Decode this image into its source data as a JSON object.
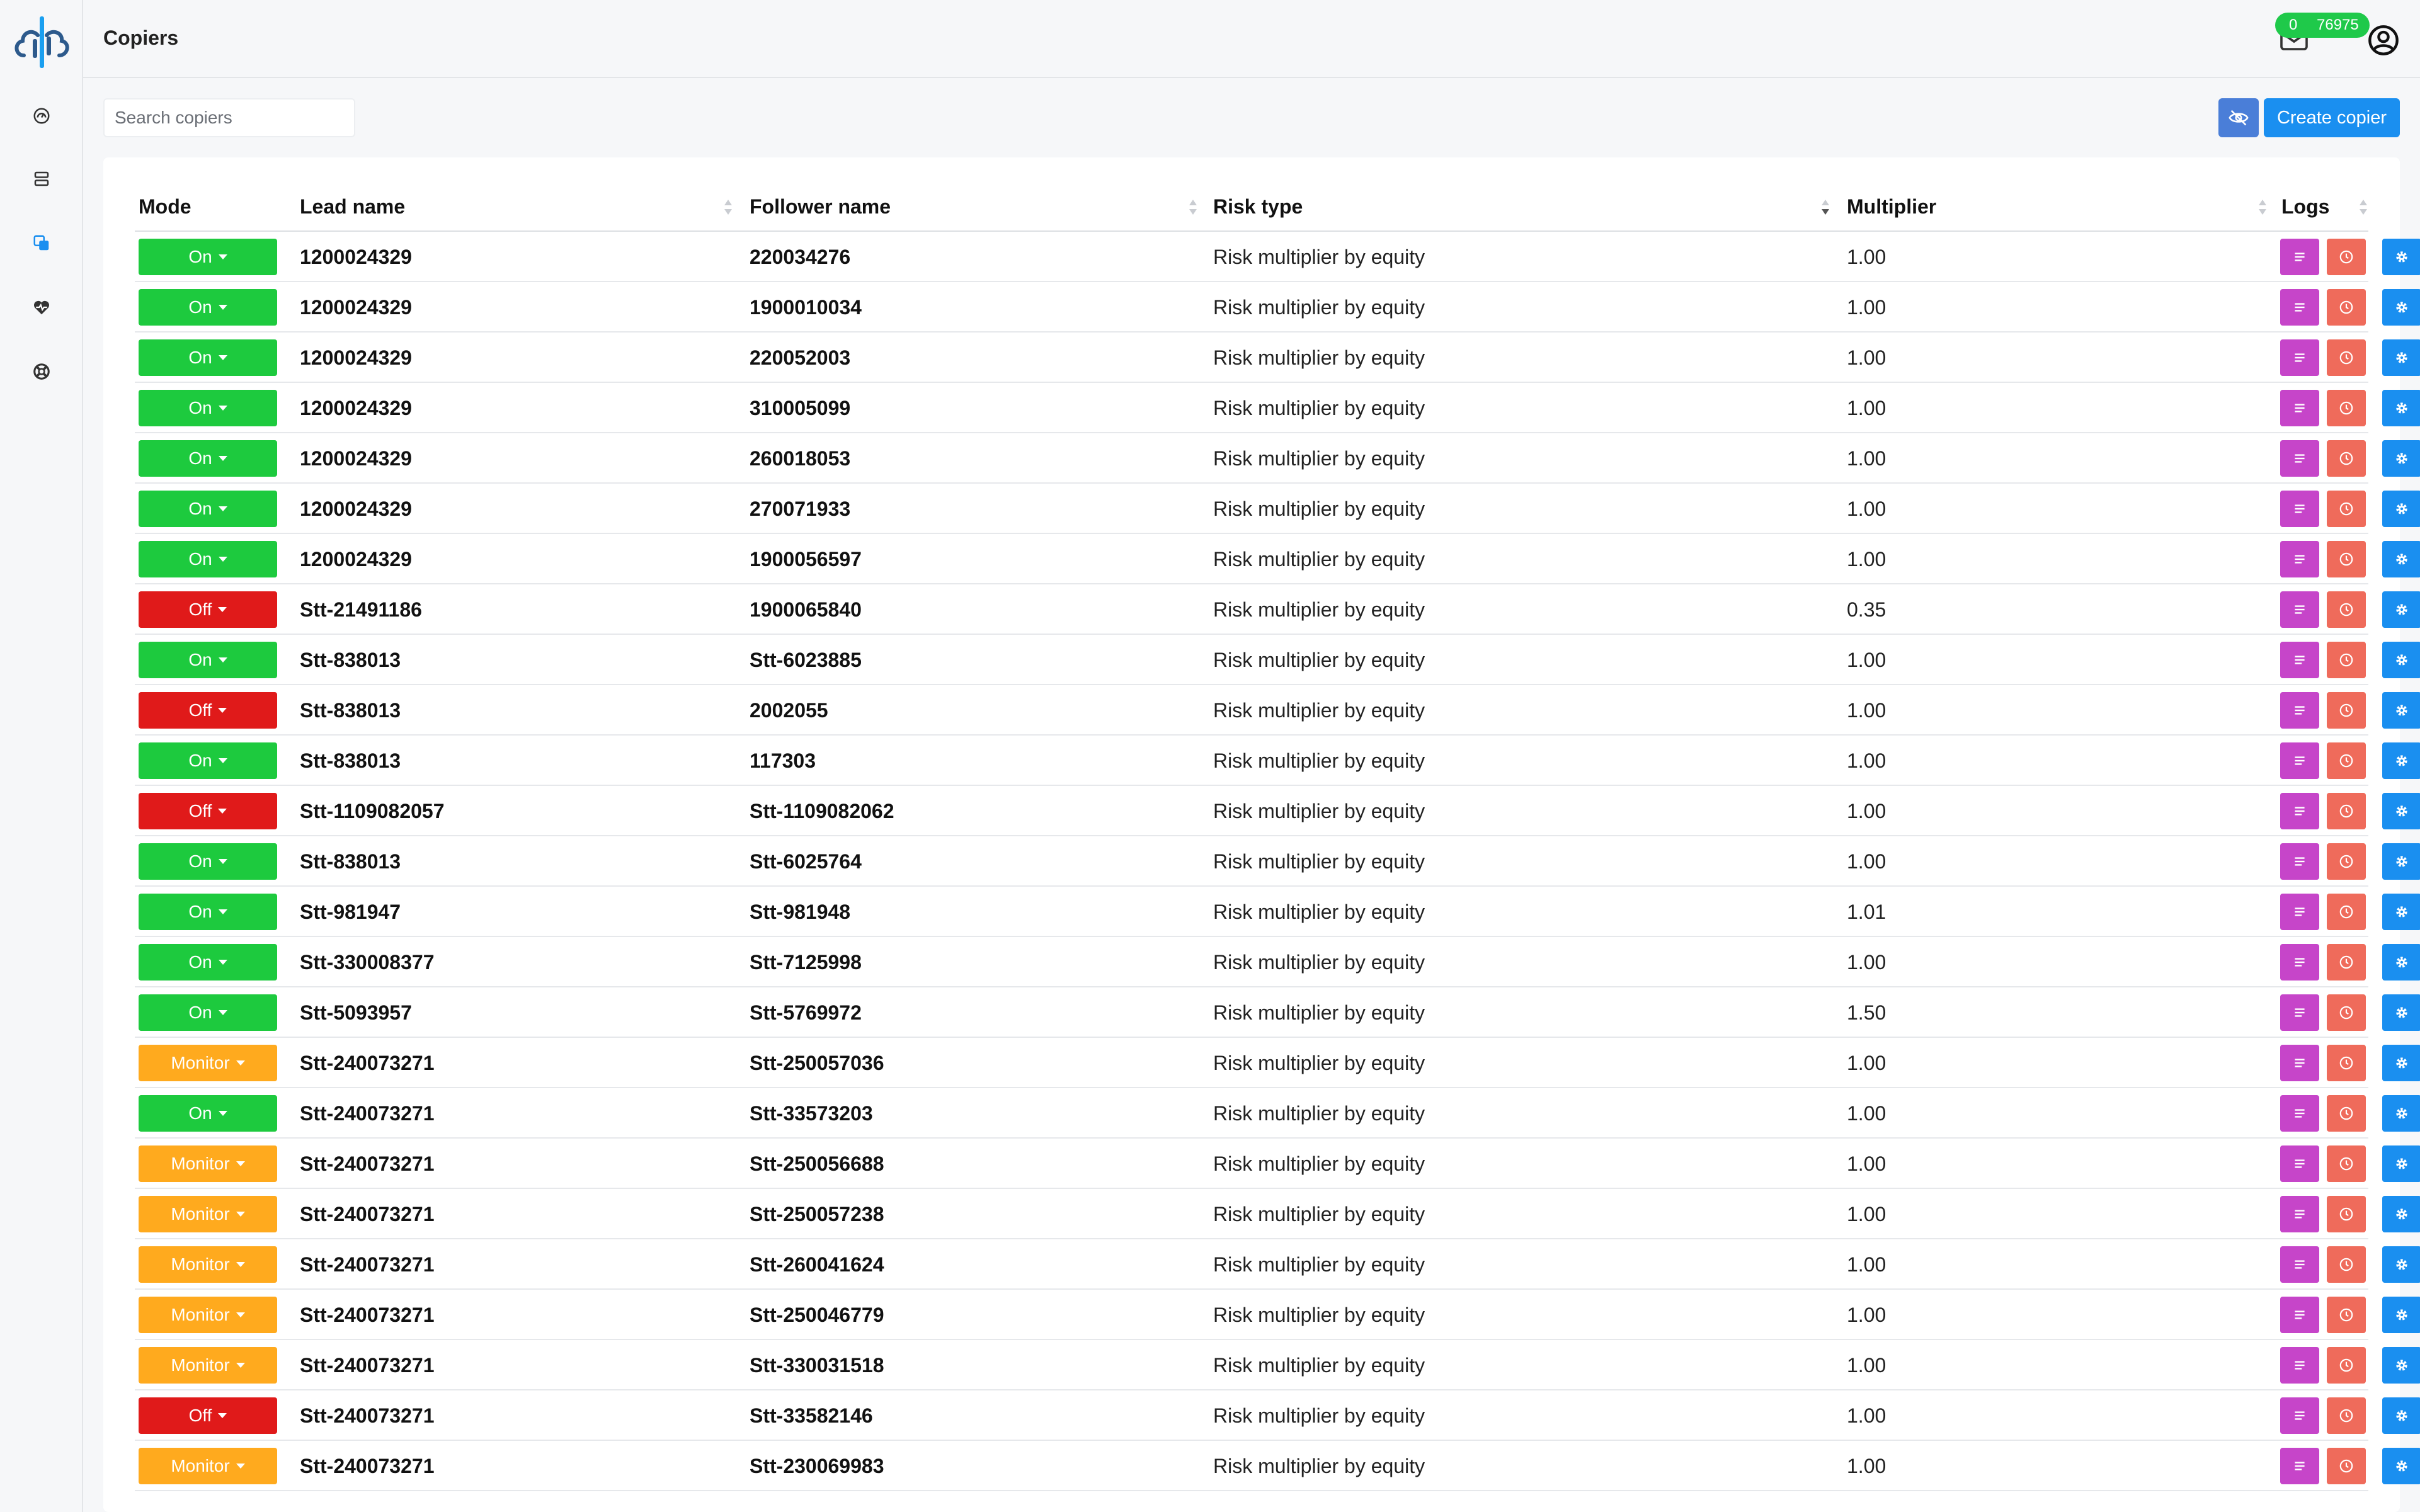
{
  "header": {
    "title": "Copiers",
    "badge_left": "0",
    "badge_right": "76975"
  },
  "search": {
    "placeholder": "Search copiers"
  },
  "toolbar": {
    "create_label": "Create copier"
  },
  "columns": {
    "mode": "Mode",
    "lead": "Lead name",
    "follower": "Follower name",
    "risk": "Risk type",
    "multiplier": "Multiplier",
    "logs": "Logs"
  },
  "colors": {
    "on": "#1dca3e",
    "off": "#e01a1a",
    "monitor": "#ffaa1e",
    "accent": "#1a8ff0",
    "logs": "#c645c9",
    "history": "#ef6b5b"
  },
  "rows": [
    {
      "mode": "On",
      "lead": "1200024329",
      "follower": "220034276",
      "risk": "Risk multiplier by equity",
      "multiplier": "1.00"
    },
    {
      "mode": "On",
      "lead": "1200024329",
      "follower": "1900010034",
      "risk": "Risk multiplier by equity",
      "multiplier": "1.00"
    },
    {
      "mode": "On",
      "lead": "1200024329",
      "follower": "220052003",
      "risk": "Risk multiplier by equity",
      "multiplier": "1.00"
    },
    {
      "mode": "On",
      "lead": "1200024329",
      "follower": "310005099",
      "risk": "Risk multiplier by equity",
      "multiplier": "1.00"
    },
    {
      "mode": "On",
      "lead": "1200024329",
      "follower": "260018053",
      "risk": "Risk multiplier by equity",
      "multiplier": "1.00"
    },
    {
      "mode": "On",
      "lead": "1200024329",
      "follower": "270071933",
      "risk": "Risk multiplier by equity",
      "multiplier": "1.00"
    },
    {
      "mode": "On",
      "lead": "1200024329",
      "follower": "1900056597",
      "risk": "Risk multiplier by equity",
      "multiplier": "1.00"
    },
    {
      "mode": "Off",
      "lead": "Stt-21491186",
      "follower": "1900065840",
      "risk": "Risk multiplier by equity",
      "multiplier": "0.35"
    },
    {
      "mode": "On",
      "lead": "Stt-838013",
      "follower": "Stt-6023885",
      "risk": "Risk multiplier by equity",
      "multiplier": "1.00"
    },
    {
      "mode": "Off",
      "lead": "Stt-838013",
      "follower": "2002055",
      "risk": "Risk multiplier by equity",
      "multiplier": "1.00"
    },
    {
      "mode": "On",
      "lead": "Stt-838013",
      "follower": "117303",
      "risk": "Risk multiplier by equity",
      "multiplier": "1.00"
    },
    {
      "mode": "Off",
      "lead": "Stt-1109082057",
      "follower": "Stt-1109082062",
      "risk": "Risk multiplier by equity",
      "multiplier": "1.00"
    },
    {
      "mode": "On",
      "lead": "Stt-838013",
      "follower": "Stt-6025764",
      "risk": "Risk multiplier by equity",
      "multiplier": "1.00"
    },
    {
      "mode": "On",
      "lead": "Stt-981947",
      "follower": "Stt-981948",
      "risk": "Risk multiplier by equity",
      "multiplier": "1.01"
    },
    {
      "mode": "On",
      "lead": "Stt-330008377",
      "follower": "Stt-7125998",
      "risk": "Risk multiplier by equity",
      "multiplier": "1.00"
    },
    {
      "mode": "On",
      "lead": "Stt-5093957",
      "follower": "Stt-5769972",
      "risk": "Risk multiplier by equity",
      "multiplier": "1.50"
    },
    {
      "mode": "Monitor",
      "lead": "Stt-240073271",
      "follower": "Stt-250057036",
      "risk": "Risk multiplier by equity",
      "multiplier": "1.00"
    },
    {
      "mode": "On",
      "lead": "Stt-240073271",
      "follower": "Stt-33573203",
      "risk": "Risk multiplier by equity",
      "multiplier": "1.00"
    },
    {
      "mode": "Monitor",
      "lead": "Stt-240073271",
      "follower": "Stt-250056688",
      "risk": "Risk multiplier by equity",
      "multiplier": "1.00"
    },
    {
      "mode": "Monitor",
      "lead": "Stt-240073271",
      "follower": "Stt-250057238",
      "risk": "Risk multiplier by equity",
      "multiplier": "1.00"
    },
    {
      "mode": "Monitor",
      "lead": "Stt-240073271",
      "follower": "Stt-260041624",
      "risk": "Risk multiplier by equity",
      "multiplier": "1.00"
    },
    {
      "mode": "Monitor",
      "lead": "Stt-240073271",
      "follower": "Stt-250046779",
      "risk": "Risk multiplier by equity",
      "multiplier": "1.00"
    },
    {
      "mode": "Monitor",
      "lead": "Stt-240073271",
      "follower": "Stt-330031518",
      "risk": "Risk multiplier by equity",
      "multiplier": "1.00"
    },
    {
      "mode": "Off",
      "lead": "Stt-240073271",
      "follower": "Stt-33582146",
      "risk": "Risk multiplier by equity",
      "multiplier": "1.00"
    },
    {
      "mode": "Monitor",
      "lead": "Stt-240073271",
      "follower": "Stt-230069983",
      "risk": "Risk multiplier by equity",
      "multiplier": "1.00"
    }
  ]
}
